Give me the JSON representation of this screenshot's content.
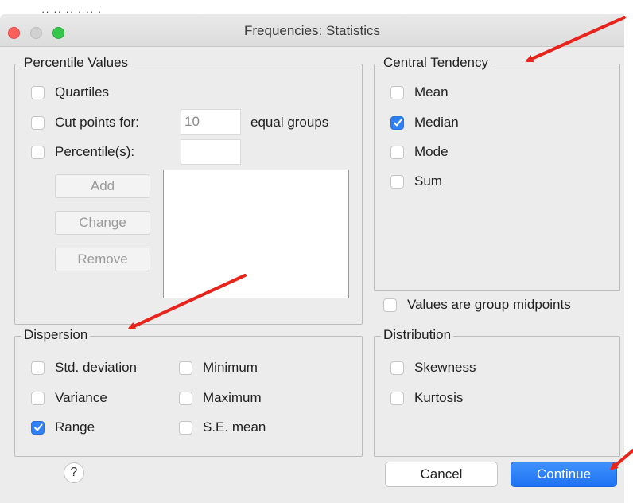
{
  "window": {
    "title": "Frequencies: Statistics",
    "background_cropped_text": "·· ··   ··  ·   ·· ·"
  },
  "percentile_values": {
    "legend": "Percentile Values",
    "quartiles": {
      "label": "Quartiles",
      "checked": false
    },
    "cut_points": {
      "label": "Cut points for:",
      "checked": false,
      "value": "10",
      "suffix": "equal groups"
    },
    "percentiles": {
      "label": "Percentile(s):",
      "checked": false,
      "value": ""
    },
    "buttons": {
      "add": "Add",
      "change": "Change",
      "remove": "Remove"
    }
  },
  "central_tendency": {
    "legend": "Central Tendency",
    "items": [
      {
        "label": "Mean",
        "checked": false
      },
      {
        "label": "Median",
        "checked": true
      },
      {
        "label": "Mode",
        "checked": false
      },
      {
        "label": "Sum",
        "checked": false
      }
    ]
  },
  "group_midpoints": {
    "label": "Values are group midpoints",
    "checked": false
  },
  "dispersion": {
    "legend": "Dispersion",
    "std_deviation": {
      "label": "Std. deviation",
      "checked": false
    },
    "minimum": {
      "label": "Minimum",
      "checked": false
    },
    "variance": {
      "label": "Variance",
      "checked": false
    },
    "maximum": {
      "label": "Maximum",
      "checked": false
    },
    "range": {
      "label": "Range",
      "checked": true
    },
    "se_mean": {
      "label": "S.E. mean",
      "checked": false
    }
  },
  "distribution": {
    "legend": "Distribution",
    "skewness": {
      "label": "Skewness",
      "checked": false
    },
    "kurtosis": {
      "label": "Kurtosis",
      "checked": false
    }
  },
  "footer": {
    "help": "?",
    "cancel": "Cancel",
    "continue": "Continue"
  },
  "colors": {
    "accent": "#2f7ff5",
    "annotation_arrow": "#e8231c",
    "window_bg": "#ececec"
  }
}
